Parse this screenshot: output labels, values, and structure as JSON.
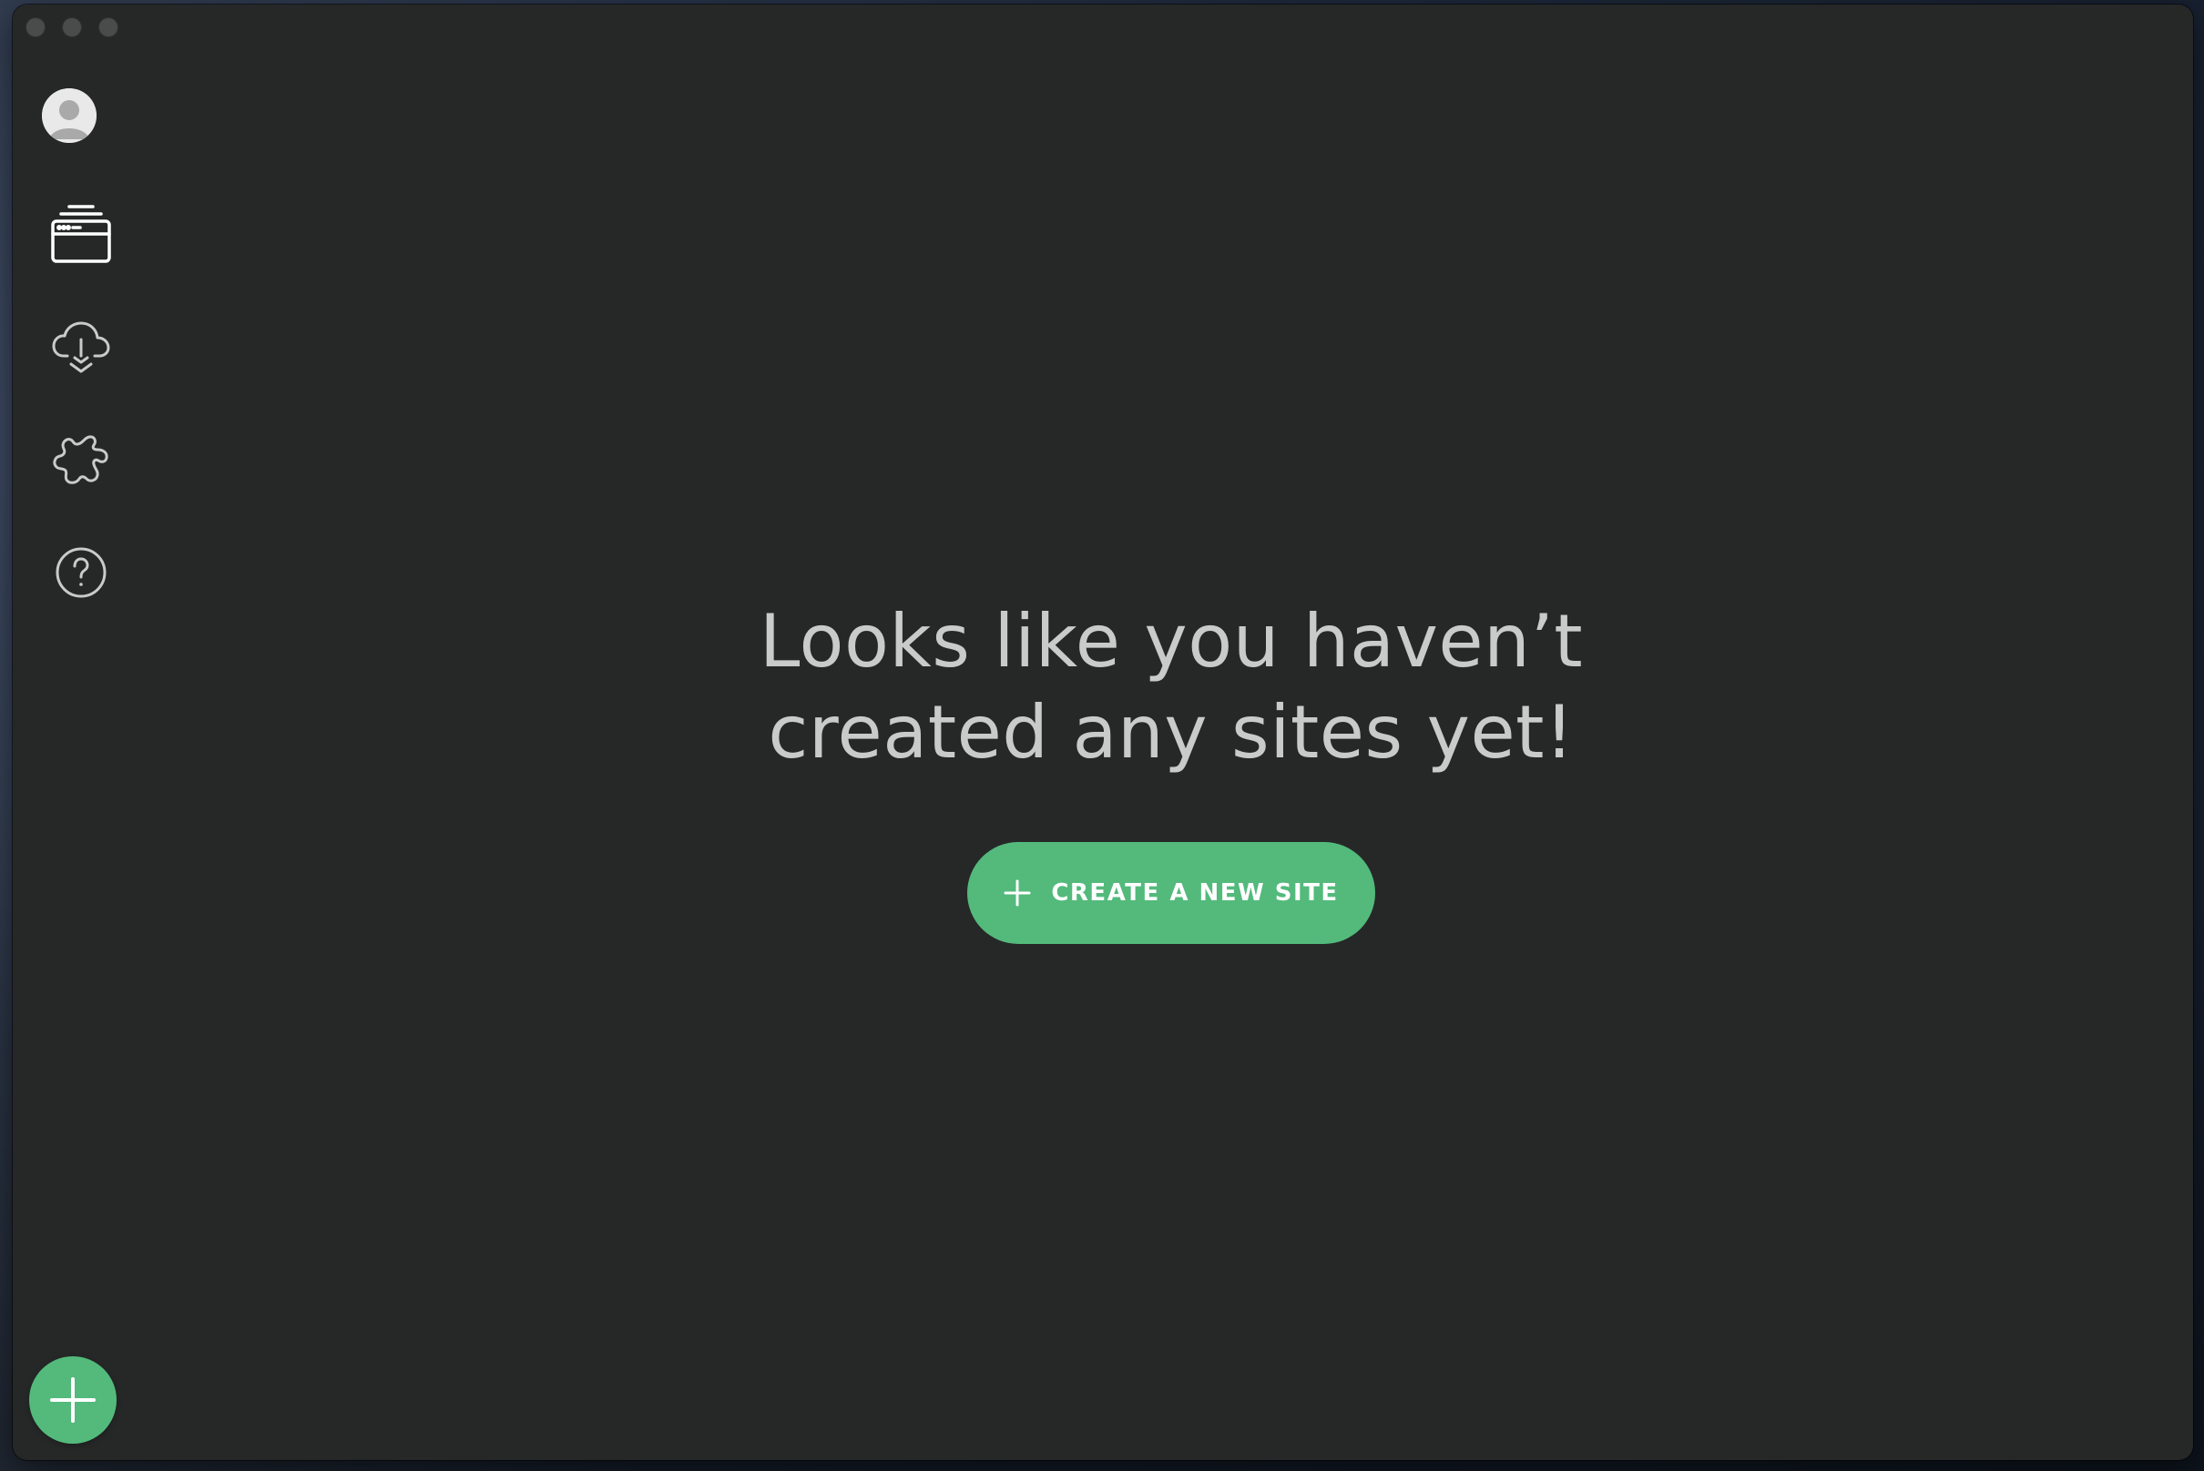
{
  "app": {
    "accent_color": "#53ba7c",
    "background_color": "#262828"
  },
  "sidebar": {
    "items": [
      {
        "id": "account",
        "icon": "user-avatar-icon"
      },
      {
        "id": "sites",
        "icon": "browser-window-stack-icon",
        "active": true
      },
      {
        "id": "connect",
        "icon": "cloud-download-icon"
      },
      {
        "id": "add-ons",
        "icon": "puzzle-piece-icon"
      },
      {
        "id": "help",
        "icon": "question-circle-icon"
      }
    ],
    "add_button_icon": "plus-icon"
  },
  "empty_state": {
    "headline_line1": "Looks like you haven’t",
    "headline_line2": "created any sites yet!",
    "create_button_label": "CREATE A NEW SITE",
    "create_button_icon": "plus-icon"
  }
}
